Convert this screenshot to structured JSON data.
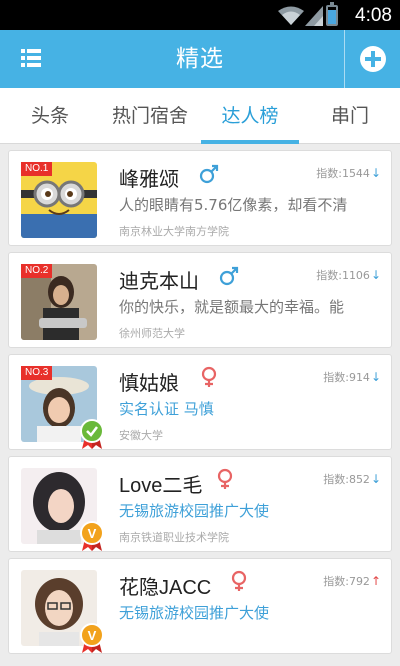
{
  "status_bar": {
    "time": "4:08"
  },
  "app_bar": {
    "title": "精选",
    "menu_icon": "list-icon",
    "add_icon": "plus-circle-icon"
  },
  "tabs": [
    {
      "label": "头条",
      "active": false
    },
    {
      "label": "热门宿舍",
      "active": false
    },
    {
      "label": "达人榜",
      "active": true
    },
    {
      "label": "串门",
      "active": false
    }
  ],
  "users": [
    {
      "rank": "NO.1",
      "name": "峰雅颂",
      "gender": "male",
      "score": "指数:1544",
      "trend": "down",
      "desc": "人的眼睛有5.76亿像素，却看不清",
      "school": "南京林业大学南方学院"
    },
    {
      "rank": "NO.2",
      "name": "迪克本山",
      "gender": "male",
      "score": "指数:1106",
      "trend": "down",
      "desc": "你的快乐，就是额最大的幸福。能",
      "school": "徐州师范大学"
    },
    {
      "rank": "NO.3",
      "name": "慎姑娘",
      "gender": "female",
      "score": "指数:914",
      "trend": "down",
      "desc": "实名认证 马慎",
      "school": "安徽大学"
    },
    {
      "rank": "",
      "name": "Love二毛",
      "gender": "female",
      "score": "指数:852",
      "trend": "down",
      "desc": "无锡旅游校园推广大使",
      "school": "南京铁道职业技术学院"
    },
    {
      "rank": "",
      "name": "花隐JACC",
      "gender": "female",
      "score": "指数:792",
      "trend": "up",
      "desc": "无锡旅游校园推广大使",
      "school": ""
    }
  ],
  "colors": {
    "accent": "#46b2e4",
    "rank_badge": "#e8302a",
    "male": "#3ea0d8",
    "female": "#e86464",
    "trend_down": "#3ea0d8",
    "trend_up": "#e24848"
  }
}
